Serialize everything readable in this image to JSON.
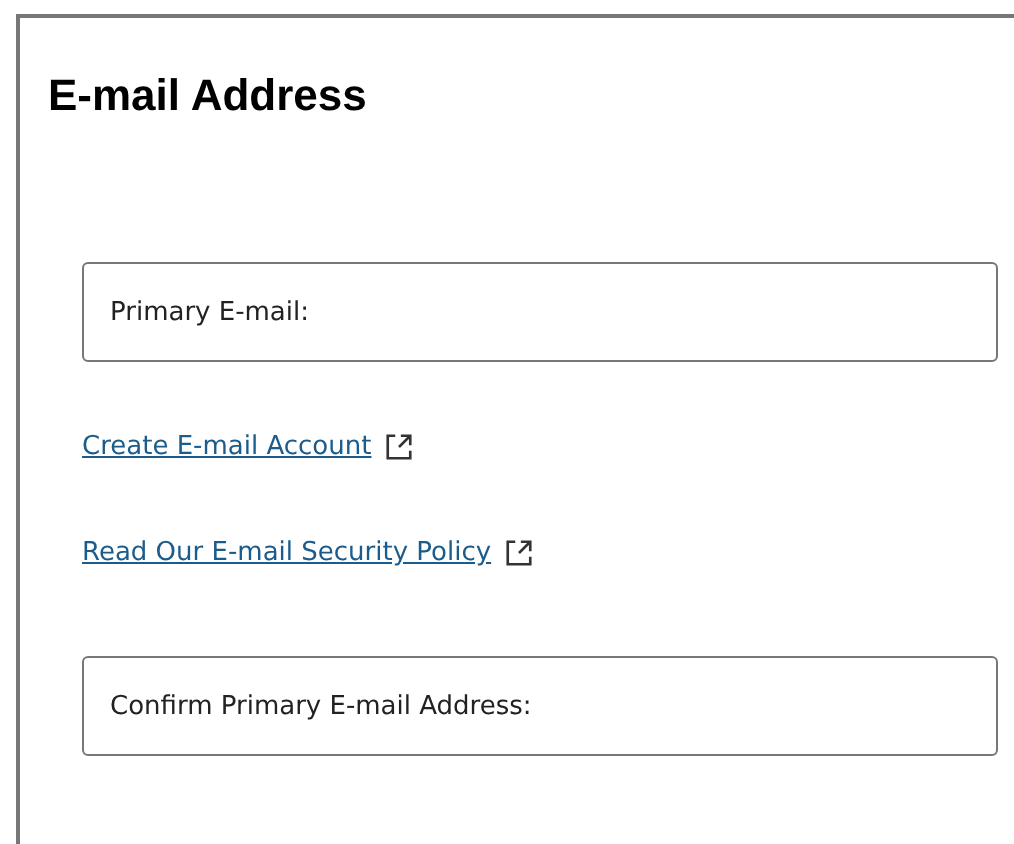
{
  "title": "E-mail Address",
  "items": [
    {
      "kind": "field",
      "placeholder": "Primary E-mail:"
    },
    {
      "kind": "link",
      "label": "Create E-mail Account"
    },
    {
      "kind": "link",
      "label": "Read Our E-mail Security Policy"
    },
    {
      "kind": "field",
      "placeholder": "Confirm Primary E-mail Address:"
    }
  ]
}
